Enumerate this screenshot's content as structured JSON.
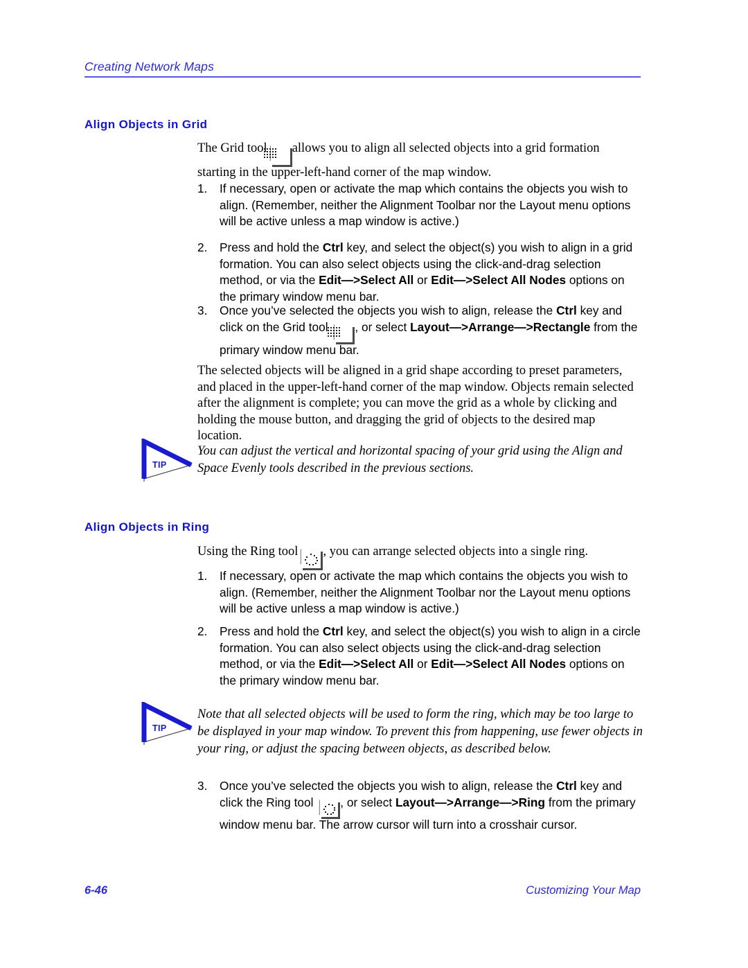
{
  "header": {
    "title": "Creating Network Maps",
    "rule_color": "#5555e8"
  },
  "sections": [
    {
      "heading": "Align Objects in Grid",
      "intro_before_icon": "The Grid tool",
      "icon": "grid-tool-icon",
      "intro_after_icon": "allows you to align all selected objects into a grid formation starting in the upper-left-hand corner of the map window.",
      "steps": [
        {
          "number": "1.",
          "text": "If necessary, open or activate the map which contains the objects you wish to align. (Remember, neither the Alignment Toolbar nor the Layout menu options will be active unless a map window is active.)"
        },
        {
          "number": "2.",
          "text_1": "Press and hold the ",
          "bold_1": "Ctrl",
          "text_2": " key, and select the object(s) you wish to align in a grid formation. You can also select objects using the click-and-drag selection method, or via the ",
          "bold_2": "Edit—>Select All",
          "text_3": " or ",
          "bold_3": "Edit—>Select All Nodes",
          "text_4": " options on the primary window menu bar."
        },
        {
          "number": "3.",
          "text_1": "Once you’ve selected the objects you wish to align, release the ",
          "bold_1": "Ctrl",
          "text_2": " key and click on the Grid tool ",
          "icon": "grid-tool-icon",
          "text_3": ", or select ",
          "bold_2": "Layout—>Arrange—>Rectangle",
          "text_4": " from the primary window menu bar."
        }
      ],
      "closing_paragraph": "The selected objects will be aligned in a grid shape according to preset parameters, and placed in the upper-left-hand corner of the map window. Objects remain selected after the alignment is complete; you can move the grid as a whole by clicking and holding the mouse button, and dragging the grid of objects to the desired map location.",
      "tip": {
        "label": "TIP",
        "text": "You can adjust the vertical and horizontal spacing of your grid using the Align and Space Evenly tools described in the previous sections."
      }
    },
    {
      "heading": "Align Objects in Ring",
      "intro_before_icon": "Using the Ring tool",
      "icon": "ring-tool-icon",
      "intro_after_icon": ", you can arrange selected objects into a single ring.",
      "steps": [
        {
          "number": "1.",
          "text": "If necessary, open or activate the map which contains the objects you wish to align. (Remember, neither the Alignment Toolbar nor the Layout menu options will be active unless a map window is active.)"
        },
        {
          "number": "2.",
          "text_1": "Press and hold the ",
          "bold_1": "Ctrl",
          "text_2": " key, and select the object(s) you wish to align in a circle formation. You can also select objects using the click-and-drag selection method, or via the ",
          "bold_2": "Edit—>Select All",
          "text_3": " or ",
          "bold_3": "Edit—>Select All Nodes",
          "text_4": " options on the primary window menu bar."
        },
        {
          "number": "3.",
          "text_1": "Once you’ve selected the objects you wish to align, release the ",
          "bold_1": "Ctrl",
          "text_2": " key and click the Ring tool ",
          "icon": "ring-tool-icon",
          "text_3": ", or select ",
          "bold_2": "Layout—>Arrange—>Ring",
          "text_4": " from the primary window menu bar. The arrow cursor will turn into a crosshair cursor."
        }
      ],
      "tip": {
        "label": "TIP",
        "text": "Note that all selected objects will be used to form the ring, which may be too large to be displayed in your map window. To prevent this from happening, use fewer objects in your ring, or adjust the spacing between objects, as described below."
      }
    }
  ],
  "footer": {
    "page_number": "6-46",
    "section_name": "Customizing Your Map"
  },
  "colors": {
    "heading_blue": "#1414cc",
    "header_blue": "#2b2bd4",
    "tip_blue": "#1a1ad0",
    "rule_blue": "#5555e8"
  }
}
